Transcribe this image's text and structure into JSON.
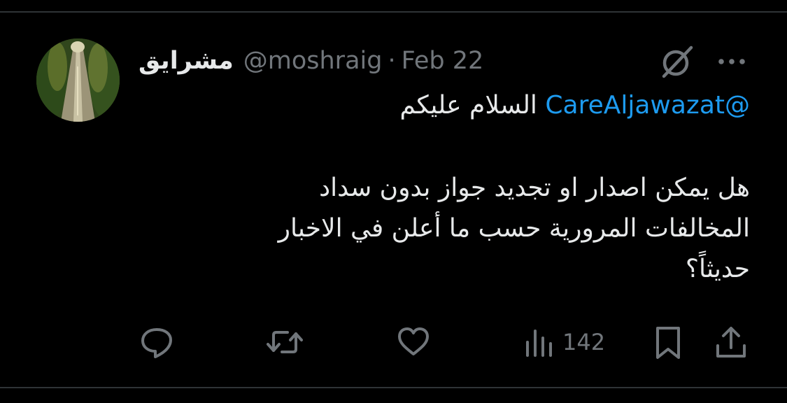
{
  "tweet": {
    "display_name": "مشرايق",
    "handle": "@moshraig",
    "separator": "·",
    "date": "Feb 22",
    "mention": "@CareAljawazat",
    "greeting": "السلام عليكم",
    "lines": [
      "هل يمكن اصدار او تجديد جواز بدون سداد",
      "المخالفات المرورية حسب ما أعلن في الاخبار",
      "حديثاً؟"
    ]
  },
  "actions": {
    "views": "142"
  },
  "icons": {
    "grok": "grok-slash-circle-icon",
    "more": "more-horizontal-icon",
    "reply": "reply-bubble-icon",
    "retweet": "retweet-icon",
    "like": "heart-icon",
    "views": "bar-chart-icon",
    "bookmark": "bookmark-icon",
    "share": "share-upload-icon"
  },
  "colors": {
    "background": "#000000",
    "text": "#e7e9ea",
    "secondary": "#71767b",
    "mention": "#1d9bf0",
    "divider": "#2f3336"
  }
}
